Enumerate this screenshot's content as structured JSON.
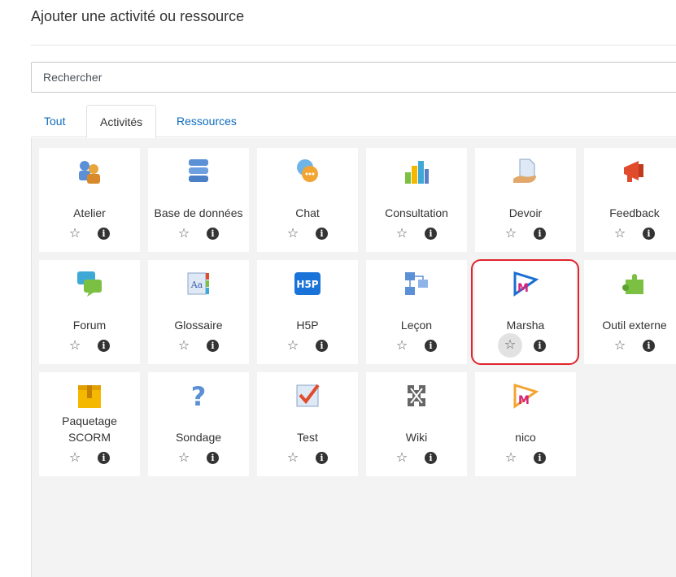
{
  "modal": {
    "title": "Ajouter une activité ou ressource"
  },
  "search": {
    "placeholder": "Rechercher"
  },
  "tabs": [
    {
      "label": "Tout",
      "active": false
    },
    {
      "label": "Activités",
      "active": true
    },
    {
      "label": "Ressources",
      "active": false
    }
  ],
  "activities": [
    {
      "name": "Atelier",
      "icon": "workshop-icon"
    },
    {
      "name": "Base de données",
      "icon": "database-icon"
    },
    {
      "name": "Chat",
      "icon": "chat-icon"
    },
    {
      "name": "Consultation",
      "icon": "choice-icon"
    },
    {
      "name": "Devoir",
      "icon": "assignment-icon"
    },
    {
      "name": "Feedback",
      "icon": "feedback-icon"
    },
    {
      "name": "Forum",
      "icon": "forum-icon"
    },
    {
      "name": "Glossaire",
      "icon": "glossary-icon"
    },
    {
      "name": "H5P",
      "icon": "h5p-icon"
    },
    {
      "name": "Leçon",
      "icon": "lesson-icon"
    },
    {
      "name": "Marsha",
      "icon": "marsha-icon",
      "highlighted": true
    },
    {
      "name": "Outil externe",
      "icon": "external-tool-icon"
    },
    {
      "name": "Paquetage SCORM",
      "icon": "scorm-icon"
    },
    {
      "name": "Sondage",
      "icon": "survey-icon"
    },
    {
      "name": "Test",
      "icon": "quiz-icon"
    },
    {
      "name": "Wiki",
      "icon": "wiki-icon"
    },
    {
      "name": "nico",
      "icon": "nico-icon"
    }
  ],
  "actions": {
    "star": "☆",
    "info": "i"
  },
  "colors": {
    "link": "#0f6cbf",
    "highlight": "#e0242c",
    "grid_bg": "#f3f3f3"
  }
}
